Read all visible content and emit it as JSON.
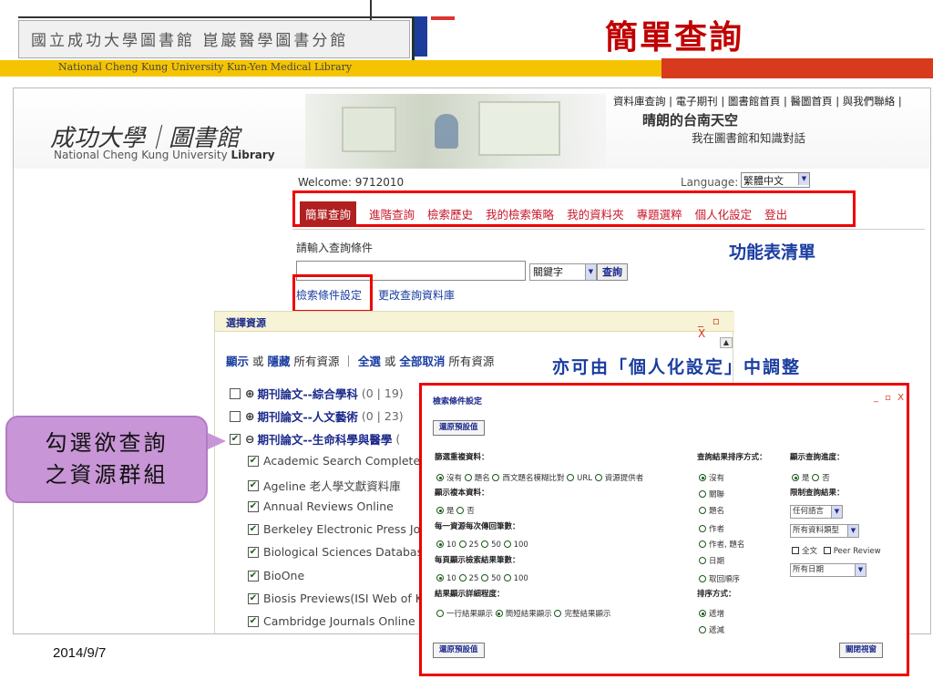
{
  "slide": {
    "header_text": "國立成功大學圖書館 崑巖醫學圖書分館",
    "header_en": "National Cheng Kung University Kun-Yen Medical Library",
    "title": "簡單查詢",
    "date": "2014/9/7"
  },
  "library": {
    "logo_script": "成功大學｜圖書館",
    "logo_sub_prefix": "National Cheng Kung University ",
    "logo_sub_bold": "Library",
    "top_links": "資料庫查詢 | 電子期刊 | 圖書館首頁 | 醫圖首頁 | 與我們聯絡 |",
    "slogan1": "晴朗的台南天空",
    "slogan2": "我在圖書館和知識對話",
    "welcome": "Welcome: 9712010",
    "language_label": "Language:",
    "language_value": "繁體中文",
    "menu": [
      "簡單查詢",
      "進階查詢",
      "檢索歷史",
      "我的檢索策略",
      "我的資料夾",
      "專題選粹",
      "個人化設定",
      "登出"
    ],
    "search_label": "請輸入查詢條件",
    "search_value": "",
    "field_select": "關鍵字",
    "search_button": "查詢",
    "search_settings_link": "檢索條件設定",
    "change_db_link": "更改查詢資料庫"
  },
  "resource_panel": {
    "title": "選擇資源",
    "controls": "_ ▫ X",
    "toolbar": {
      "show": "顯示",
      "or1": " 或 ",
      "hide": "隱藏",
      "all1": " 所有資源 ｜ ",
      "select_all": "全選",
      "or2": " 或 ",
      "deselect_all": "全部取消",
      "all2": " 所有資源"
    },
    "groups": [
      {
        "symbol": "⊕",
        "label": "期刊論文--綜合學科",
        "count": "(0 | 19)",
        "checked": false
      },
      {
        "symbol": "⊕",
        "label": "期刊論文--人文藝術",
        "count": "(0 | 23)",
        "checked": false
      },
      {
        "symbol": "⊖",
        "label": "期刊論文--生命科學與醫學",
        "count": "(",
        "checked": true
      }
    ],
    "items": [
      "Academic Search Complete |",
      "Ageline 老人學文獻資料庫",
      "Annual Reviews Online",
      "Berkeley Electronic Press Jo",
      "Biological Sciences Databas",
      "BioOne",
      "Biosis Previews(ISI Web of K",
      "Cambridge Journals Online"
    ]
  },
  "callouts": {
    "menu": "功能表清單",
    "adjust": "亦可由「個人化設定」中調整",
    "group_line1": "勾選欲查詢",
    "group_line2": "之資源群組"
  },
  "settings_dialog": {
    "title": "檢索條件設定",
    "controls": "_ ▫ X",
    "restore_default_top": "還原預設值",
    "dedupe_label": "篩選重複資料：",
    "dedupe_options": [
      "沒有",
      "題名",
      "西文題名模糊比對",
      "URL",
      "資源提供者"
    ],
    "show_copy_label": "顯示複本資料：",
    "show_copy_options": [
      "是",
      "否"
    ],
    "per_source_label": "每一資源每次傳回筆數：",
    "per_source_options": [
      "10",
      "25",
      "50",
      "100"
    ],
    "per_page_label": "每頁顯示檢索結果筆數：",
    "per_page_options": [
      "10",
      "25",
      "50",
      "100"
    ],
    "detail_label": "結果顯示詳細程度：",
    "detail_options": [
      "一行結果顯示",
      "簡短結果顯示",
      "完整結果顯示"
    ],
    "sort_label": "查詢結果排序方式：",
    "sort_options": [
      "沒有",
      "關聯",
      "題名",
      "作者",
      "作者, 題名",
      "日期",
      "取回順序"
    ],
    "order_label": "排序方式：",
    "order_options": [
      "遞增",
      "遞減"
    ],
    "progress_label": "顯示查詢進度：",
    "progress_options": [
      "是",
      "否"
    ],
    "limit_label": "限制查詢結果：",
    "limit_language": "任何語言",
    "limit_type": "所有資料類型",
    "fulltext": "全文",
    "peer_review": "Peer Review",
    "limit_date": "所有日期",
    "restore_default_bottom": "還原預設值",
    "close_window": "關閉視窗"
  }
}
